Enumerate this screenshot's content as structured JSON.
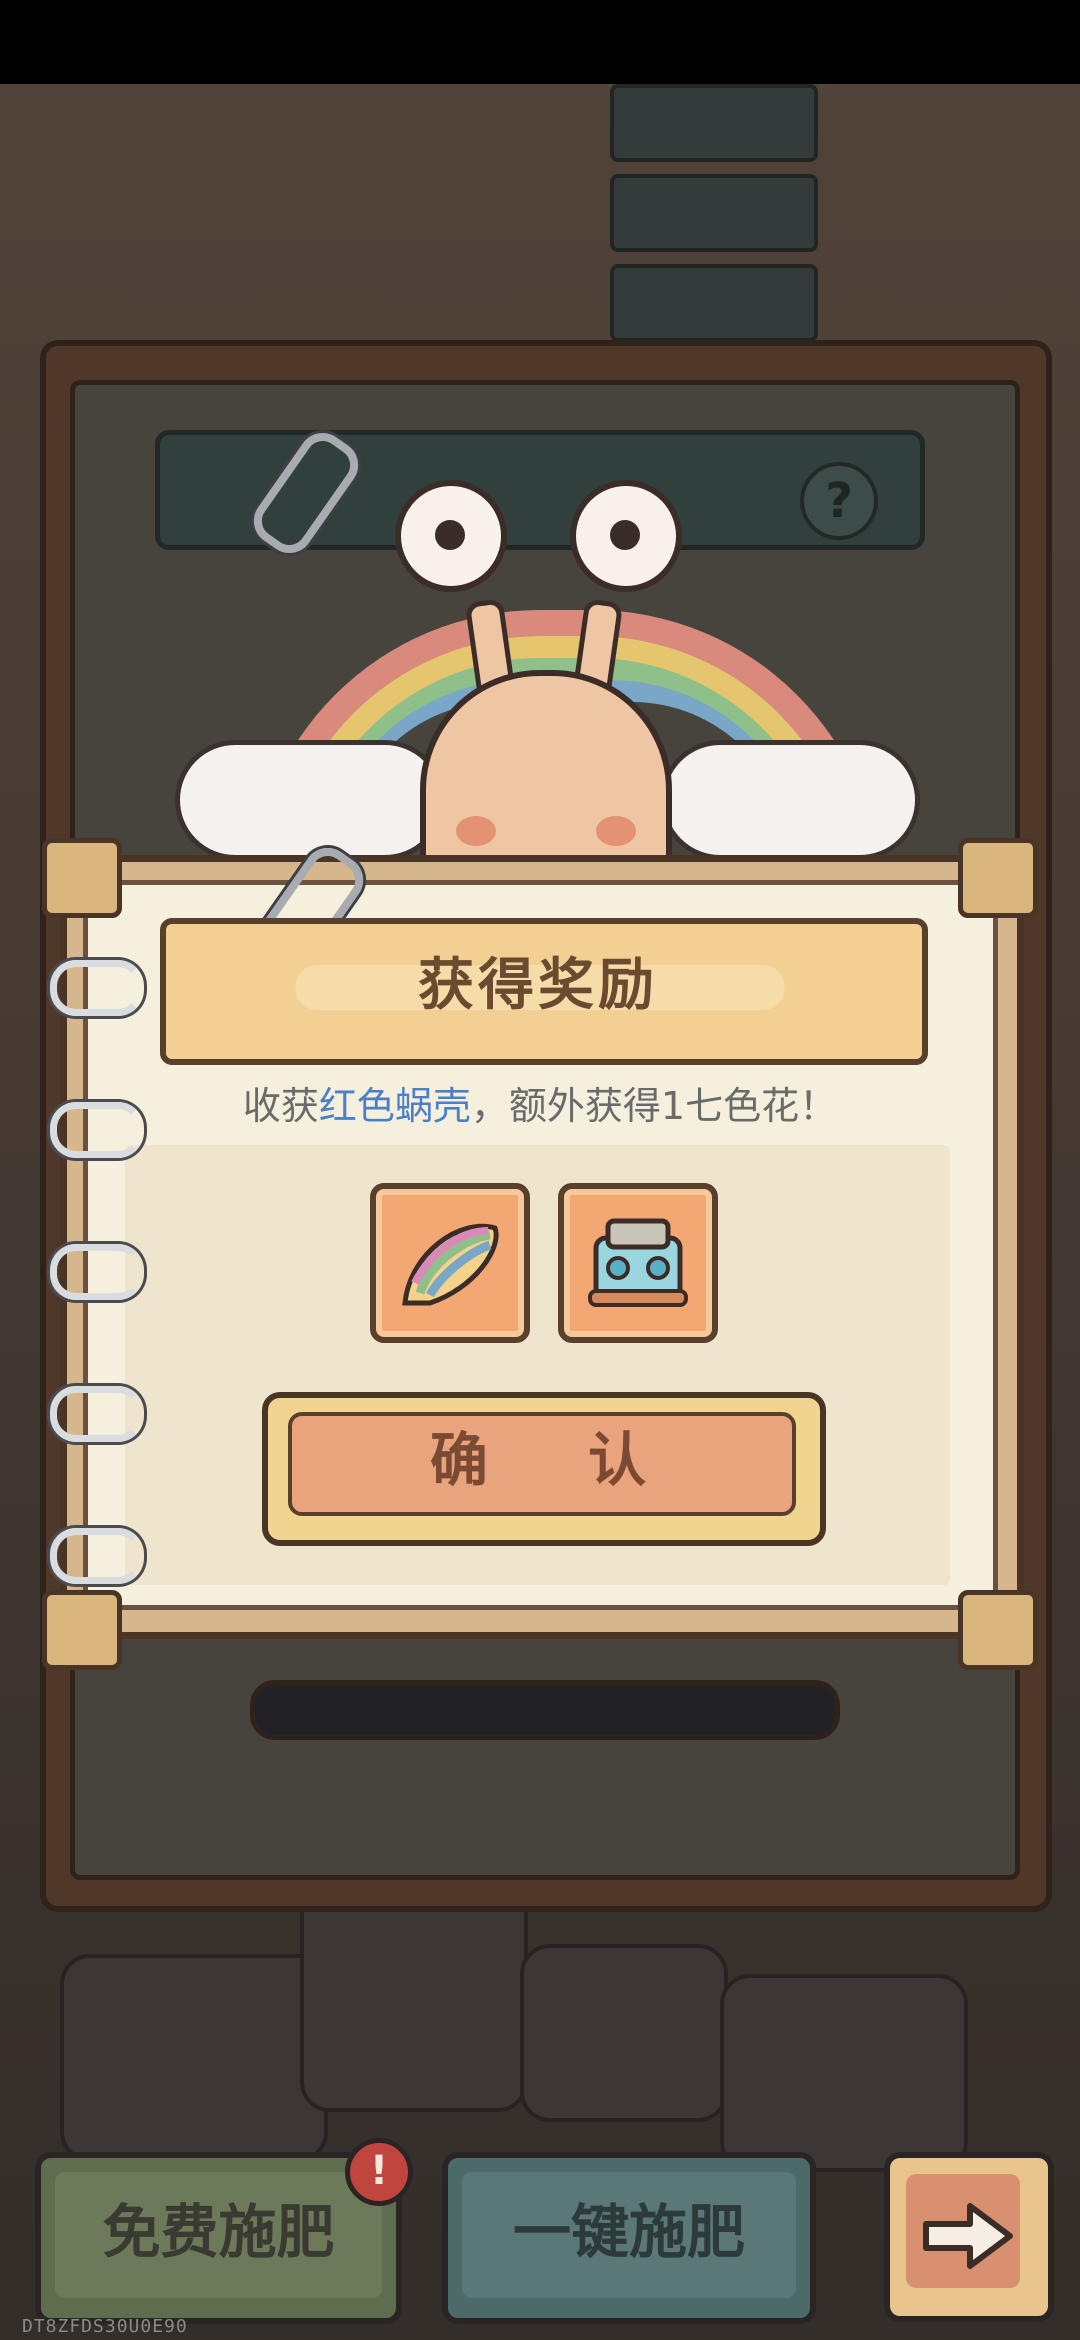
{
  "dialog": {
    "title": "获得奖励",
    "reward_prefix": "收获",
    "reward_highlight": "红色蜗壳",
    "reward_suffix": "，额外获得1七色花！",
    "items": [
      {
        "name": "rainbow-shell",
        "icon": "shell-icon"
      },
      {
        "name": "mech-part",
        "icon": "machine-icon"
      }
    ],
    "confirm_label": "确 认"
  },
  "bottom_bar": {
    "free_fertilize_label": "免费施肥",
    "badge_text": "!",
    "one_key_fertilize_label": "一键施肥",
    "next_icon": "arrow-right-icon"
  },
  "device_id": "DT8ZFDS30U0E90",
  "colors": {
    "highlight": "#4d7fc8",
    "title_banner": "#f2cf92",
    "confirm_button": "#e9a37d",
    "badge": "#c0453e"
  }
}
